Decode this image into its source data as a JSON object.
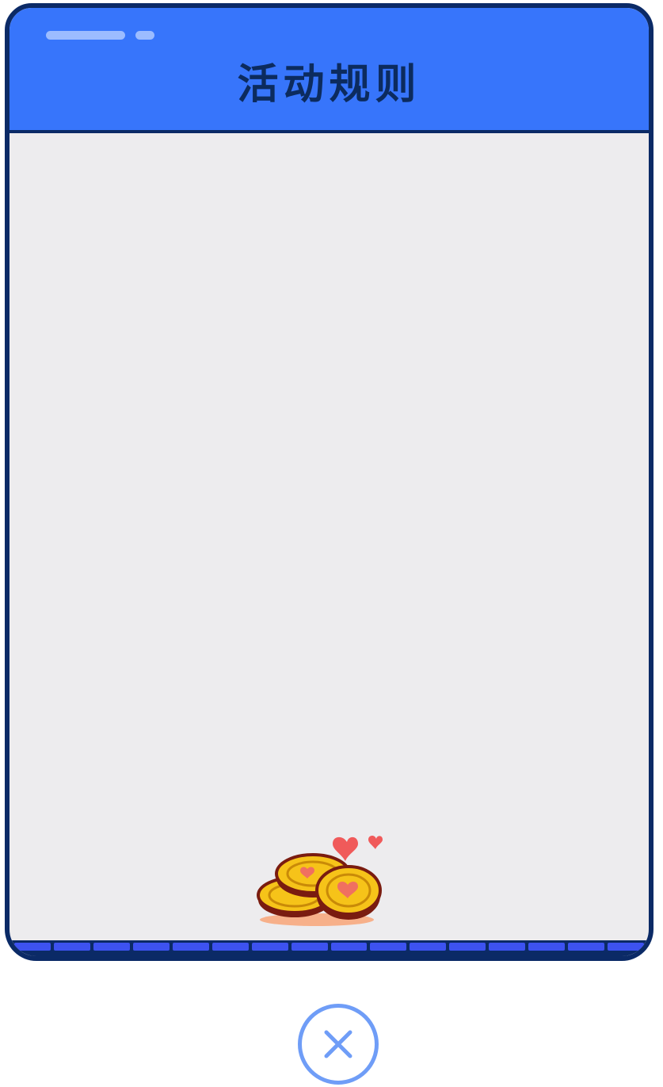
{
  "dialog": {
    "title": "活动规则"
  },
  "icons": {
    "decoration": "coin-stack-icon",
    "close": "close-icon"
  },
  "colors": {
    "header": "#3775fb",
    "border": "#0b2a66",
    "body": "#edecee",
    "close": "#6f9df7"
  }
}
